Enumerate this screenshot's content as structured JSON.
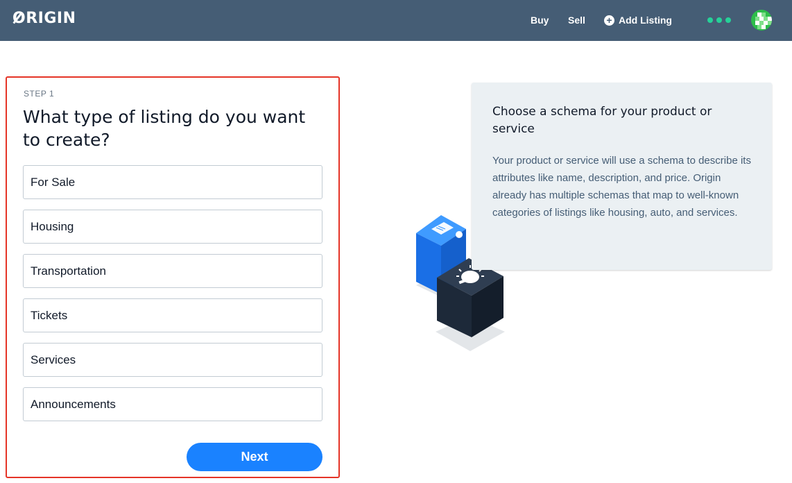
{
  "navbar": {
    "logo": "ORIGIN",
    "logo_rest": "RIGIN",
    "buy": "Buy",
    "sell": "Sell",
    "add_listing": "Add Listing"
  },
  "form": {
    "step": "STEP 1",
    "question": "What type of listing do you want to create?",
    "options": [
      "For Sale",
      "Housing",
      "Transportation",
      "Tickets",
      "Services",
      "Announcements"
    ],
    "next": "Next"
  },
  "info": {
    "title": "Choose a schema for your product or service",
    "body": "Your product or service will use a schema to describe its attributes like name, description, and price. Origin already has multiple schemas that map to well-known categories of listings like housing, auto, and services."
  },
  "colors": {
    "navbar": "#455d75",
    "accent": "#1a82ff",
    "highlight_border": "#e53427",
    "dots": "#26d198"
  },
  "icons": [
    "plus-circle-icon",
    "more-dots-icon",
    "user-avatar",
    "schema-cubes-illustration"
  ]
}
